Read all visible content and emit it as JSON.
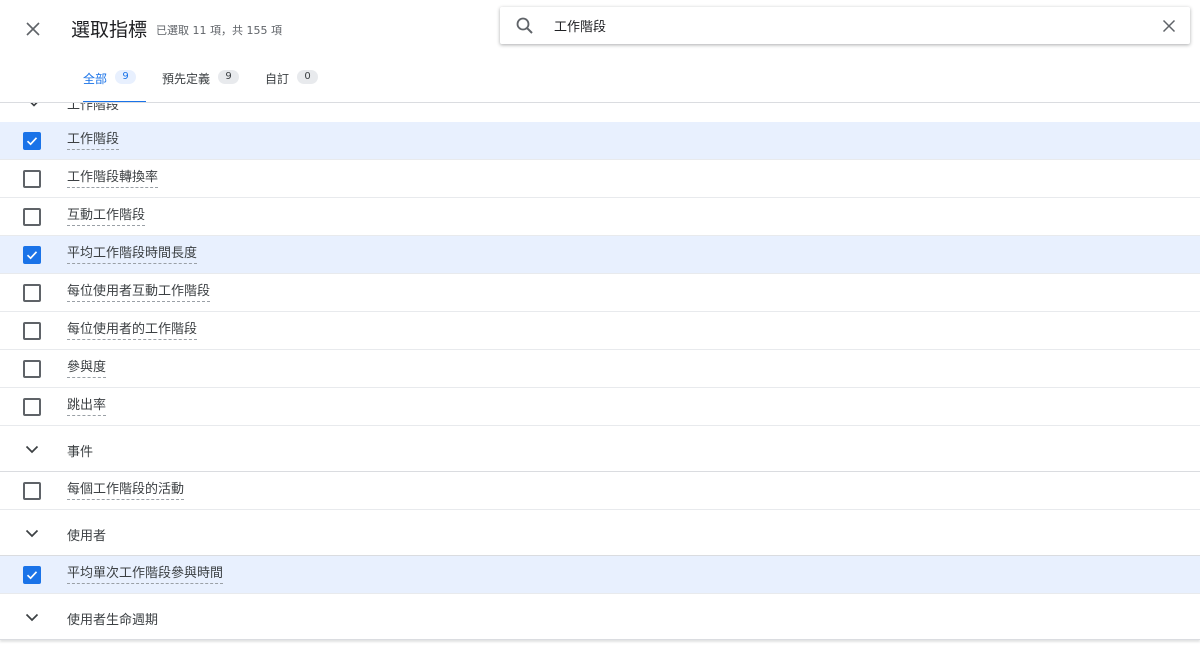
{
  "header": {
    "title": "選取指標",
    "subtitle": "已選取 11 項，共 155 項",
    "icons": {
      "close": "close-icon",
      "search": "search-icon",
      "clear": "clear-icon"
    }
  },
  "search": {
    "value": "工作階段",
    "placeholder": ""
  },
  "tabs": [
    {
      "label": "全部",
      "count": "9",
      "active": true
    },
    {
      "label": "預先定義",
      "count": "9",
      "active": false
    },
    {
      "label": "自訂",
      "count": "0",
      "active": false
    }
  ],
  "partial_group": {
    "label": "工作階段",
    "icon": "chevron-down-icon"
  },
  "list": [
    {
      "type": "item",
      "label": "工作階段",
      "checked": true
    },
    {
      "type": "item",
      "label": "工作階段轉換率",
      "checked": false
    },
    {
      "type": "item",
      "label": "互動工作階段",
      "checked": false
    },
    {
      "type": "item",
      "label": "平均工作階段時間長度",
      "checked": true
    },
    {
      "type": "item",
      "label": "每位使用者互動工作階段",
      "checked": false
    },
    {
      "type": "item",
      "label": "每位使用者的工作階段",
      "checked": false
    },
    {
      "type": "item",
      "label": "參與度",
      "checked": false
    },
    {
      "type": "item",
      "label": "跳出率",
      "checked": false
    },
    {
      "type": "group",
      "label": "事件"
    },
    {
      "type": "item",
      "label": "每個工作階段的活動",
      "checked": false
    },
    {
      "type": "group",
      "label": "使用者"
    },
    {
      "type": "item",
      "label": "平均單次工作階段參與時間",
      "checked": true
    },
    {
      "type": "group",
      "label": "使用者生命週期"
    }
  ],
  "colors": {
    "accent": "#1a73e8",
    "selected_row": "#e8f0fe",
    "text": "#3c4043",
    "divider": "#e8eaed"
  }
}
